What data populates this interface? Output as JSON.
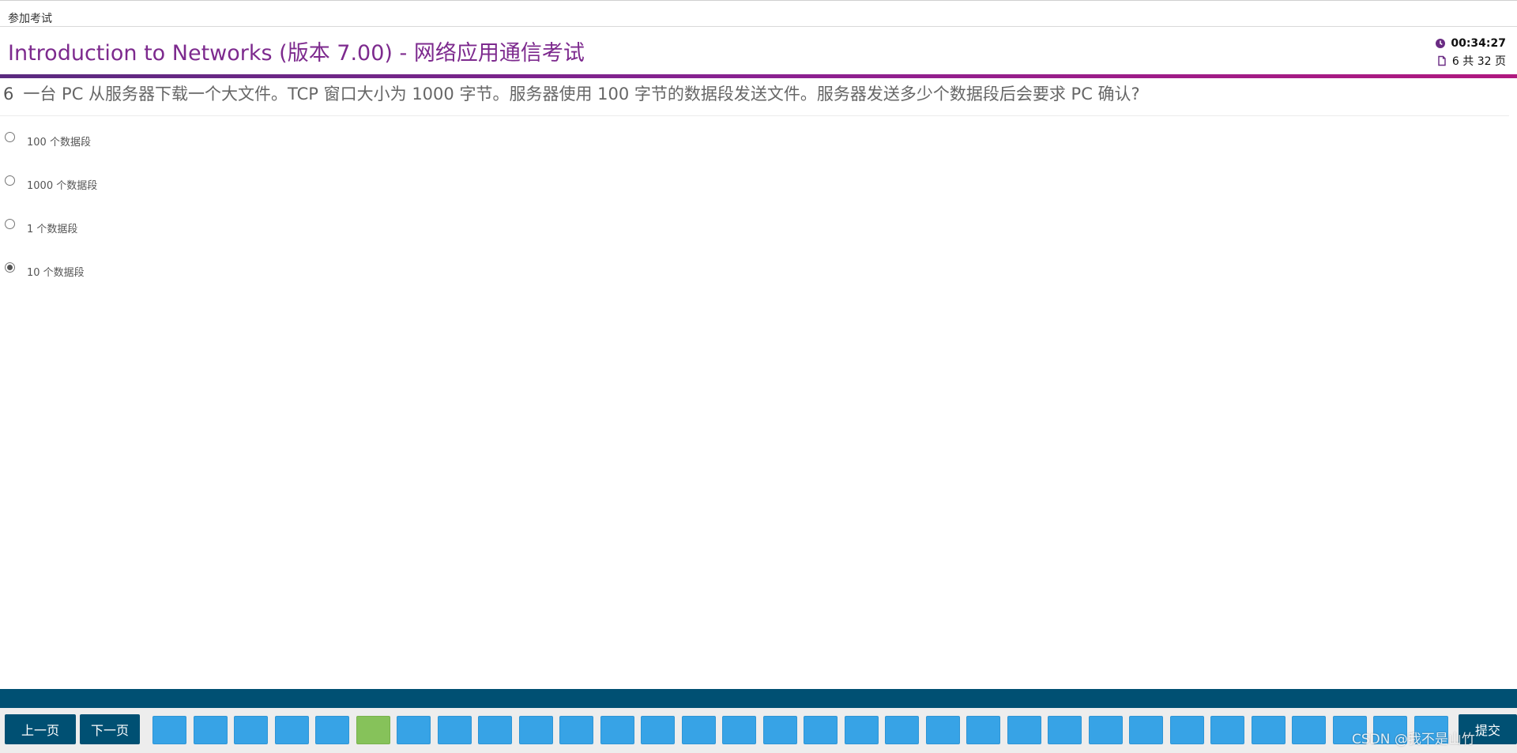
{
  "breadcrumb": "参加考试",
  "header": {
    "title": "Introduction to Networks (版本 7.00) - 网络应用通信考试",
    "timer": "00:34:27",
    "page_info": "6 共 32 页",
    "accent_color": "#7d2a8e"
  },
  "question": {
    "number": "6",
    "text": "一台 PC 从服务器下载一个大文件。TCP 窗口大小为 1000 字节。服务器使用 100 字节的数据段发送文件。服务器发送多少个数据段后会要求 PC 确认?"
  },
  "options": [
    {
      "label": "100 个数据段",
      "selected": false
    },
    {
      "label": "1000 个数据段",
      "selected": false
    },
    {
      "label": "1 个数据段",
      "selected": false
    },
    {
      "label": "10 个数据段",
      "selected": true
    }
  ],
  "footer": {
    "prev_label": "上一页",
    "next_label": "下一页",
    "submit_label": "提交",
    "total_questions": 32,
    "visible_question_buttons": 32,
    "current_question": 6,
    "current_color": "#86c25a",
    "default_color": "#37a3e6",
    "bar_color": "#005073"
  },
  "watermark": "CSDN @我不是山竹"
}
